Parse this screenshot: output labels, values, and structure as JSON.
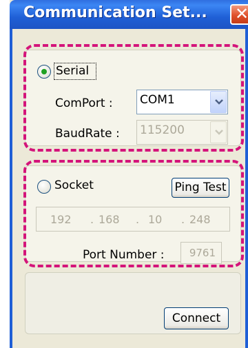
{
  "window": {
    "title": "Communication Set...",
    "close_label": "✕"
  },
  "serial": {
    "radio_label": "Serial",
    "selected": true,
    "comport_label": "ComPort :",
    "comport_value": "COM1",
    "baudrate_label": "BaudRate :",
    "baudrate_value": "115200"
  },
  "socket": {
    "radio_label": "Socket",
    "selected": false,
    "ping_button_label": "Ping Test",
    "ip": [
      "192",
      "168",
      "10",
      "248"
    ],
    "ip_dots": [
      ".",
      ".",
      "."
    ],
    "port_label": "Port Number :",
    "port_value": "9761"
  },
  "connect": {
    "button_label": "Connect"
  },
  "colors": {
    "highlight": "#d4147a",
    "titlebar": "#1f5fd6"
  }
}
